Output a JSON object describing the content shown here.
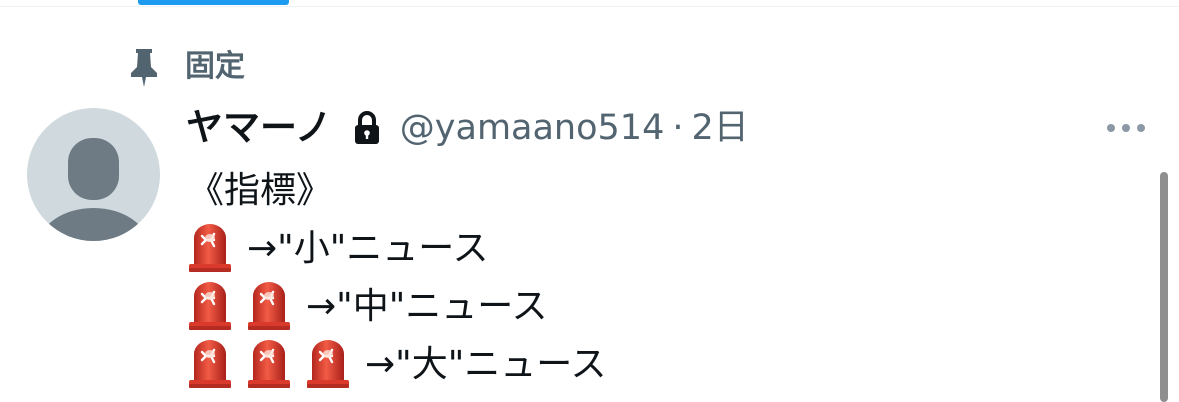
{
  "colors": {
    "accent": "#1d9bf0",
    "secondary_text": "#536471",
    "primary_text": "#0f1419",
    "avatar_bg": "#cfd9de",
    "avatar_figure": "#6e7b85",
    "siren_red": "#e2452f"
  },
  "tab_bar": {
    "active_indicator_color": "#1d9bf0"
  },
  "pinned": {
    "icon": "pin-icon",
    "label": "固定"
  },
  "tweet": {
    "author": {
      "display_name": "ヤマーノ",
      "protected_icon": "lock-icon",
      "handle": "@yamaano514",
      "avatar": "default-profile-avatar"
    },
    "separator": "·",
    "timestamp": "2日",
    "more_icon": "more-options-icon",
    "lines": [
      {
        "sirens": 0,
        "text": "《指標》"
      },
      {
        "sirens": 1,
        "text": "→\"小\"ニュース"
      },
      {
        "sirens": 2,
        "text": "→\"中\"ニュース"
      },
      {
        "sirens": 3,
        "text": "→\"大\"ニュース"
      }
    ],
    "siren_icon": "police-siren-emoji"
  }
}
